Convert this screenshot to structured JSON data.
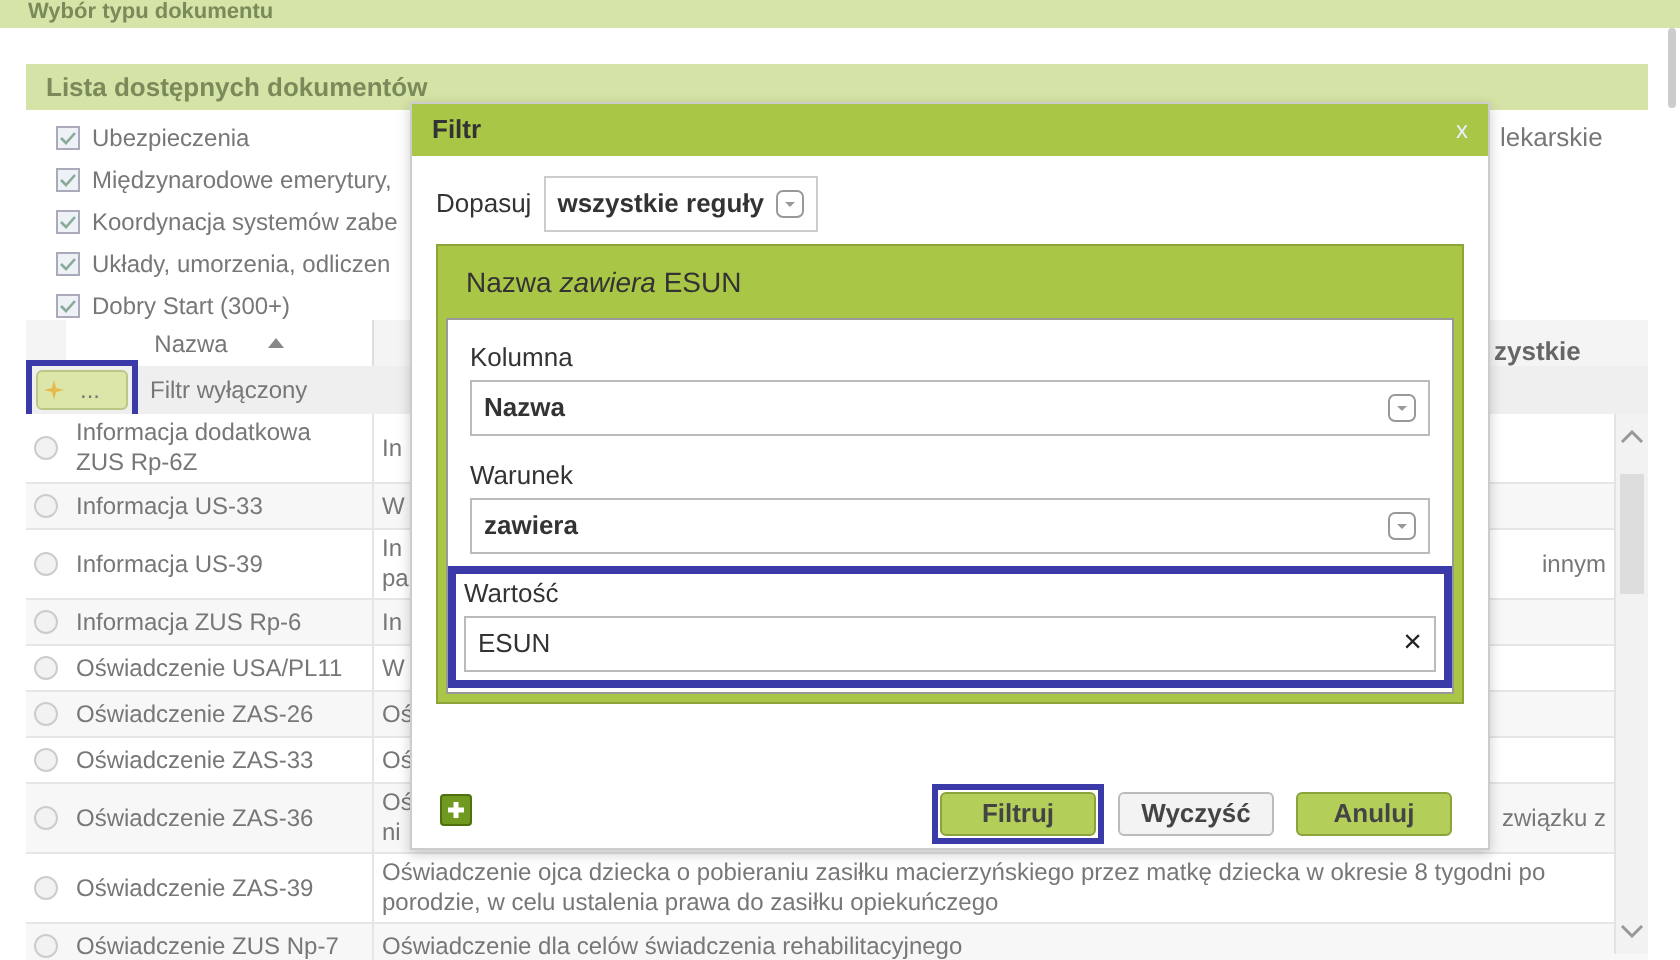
{
  "page_title": "Wybór typu dokumentu",
  "section_title": "Lista dostępnych dokumentów",
  "categories": [
    {
      "label": "Ubezpieczenia",
      "checked": true
    },
    {
      "label": "Międzynarodowe emerytury,",
      "checked": true
    },
    {
      "label": "Koordynacja systemów zabe",
      "checked": true
    },
    {
      "label": "Układy, umorzenia, odliczen",
      "checked": true
    },
    {
      "label": "Dobry Start (300+)",
      "checked": true
    }
  ],
  "category_fragment": "lekarskie",
  "scope_fragment": "zystkie",
  "table": {
    "column": "Nazwa",
    "filter_button": {
      "label": "...",
      "highlighted": true
    },
    "filter_status": "Filtr wyłączony",
    "rows": [
      {
        "name": "Informacja dodatkowa ZUS Rp-6Z",
        "description_start": "In",
        "selected": false
      },
      {
        "name": "Informacja US-33",
        "description_start": "W",
        "selected": false
      },
      {
        "name": "Informacja US-39",
        "description_start": "In pa",
        "description_end": "innym",
        "selected": false
      },
      {
        "name": "Informacja ZUS Rp-6",
        "description_start": "In",
        "selected": false
      },
      {
        "name": "Oświadczenie USA/PL11",
        "description_start": "W",
        "selected": false
      },
      {
        "name": "Oświadczenie ZAS-26",
        "description_start": "Oś",
        "selected": false
      },
      {
        "name": "Oświadczenie ZAS-33",
        "description_start": "Oś",
        "selected": false
      },
      {
        "name": "Oświadczenie ZAS-36",
        "description_start": "Oś ni",
        "description_end": "związku z",
        "selected": false
      },
      {
        "name": "Oświadczenie ZAS-39",
        "description": "Oświadczenie ojca dziecka o pobieraniu zasiłku macierzyńskiego przez matkę dziecka w okresie 8 tygodni po porodzie, w celu ustalenia prawa do zasiłku opiekuńczego",
        "selected": false
      },
      {
        "name": "Oświadczenie ZUS Np-7",
        "description": "Oświadczenie dla celów świadczenia rehabilitacyjnego",
        "selected": false
      }
    ]
  },
  "dialog": {
    "title": "Filtr",
    "close": "x",
    "match_label": "Dopasuj",
    "match_value": "wszystkie reguły",
    "rule": {
      "title": "Nazwa *zawiera* ESUN",
      "fields": [
        {
          "label": "Kolumna",
          "value": "Nazwa",
          "kind": "select",
          "highlighted": false
        },
        {
          "label": "Warunek",
          "value": "zawiera",
          "kind": "select",
          "highlighted": false
        },
        {
          "label": "Wartość",
          "value": "ESUN",
          "kind": "text",
          "clear": "×",
          "highlighted": true
        }
      ]
    },
    "buttons": [
      {
        "label": "Filtruj",
        "kind": "primary",
        "highlighted": true
      },
      {
        "label": "Wyczyść",
        "kind": "secondary",
        "highlighted": false
      },
      {
        "label": "Anuluj",
        "kind": "primary",
        "highlighted": false
      }
    ]
  }
}
